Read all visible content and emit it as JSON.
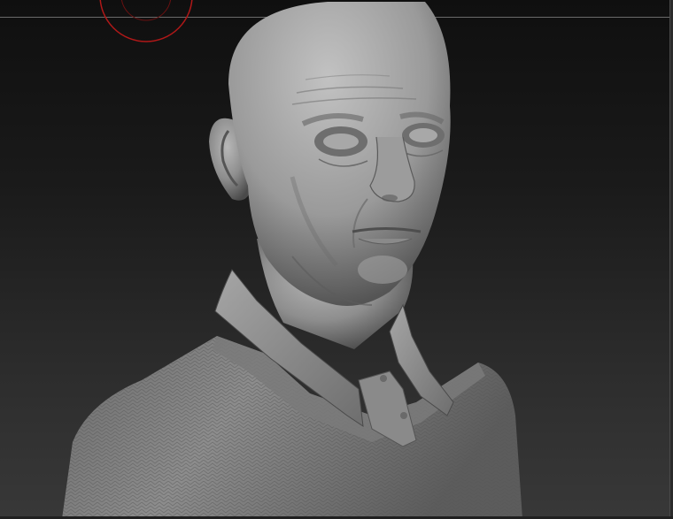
{
  "viewport": {
    "background_top": "#0f0f0f",
    "background_bottom": "#383838",
    "guide_line_color": "#6a6a6a"
  },
  "brush_cursor": {
    "icon": "brush-circle-icon",
    "color": "#b01818"
  },
  "model": {
    "icon": "sculpted-bust-model",
    "material": "matcap-gray",
    "base_color": "#8a8a8a",
    "highlight_color": "#b4b4b4",
    "shadow_color": "#3c3c3c"
  }
}
